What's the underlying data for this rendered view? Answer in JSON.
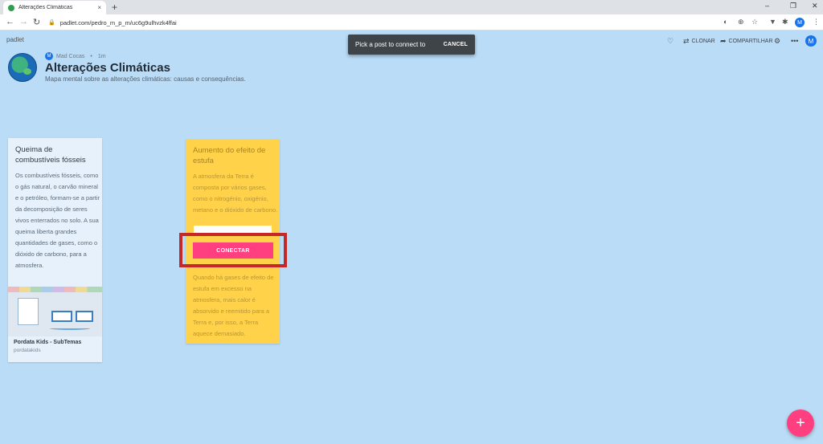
{
  "browser": {
    "tab_title": "Alterações Climáticas",
    "tab_close": "×",
    "new_tab": "+",
    "url": "padlet.com/pedro_m_p_m/uc6g9ulhvzk4ffai",
    "profile_initial": "M",
    "window_controls": [
      "–",
      "❐",
      "✕"
    ]
  },
  "padlet": {
    "logo": "padlet",
    "author": "Mad Cocas",
    "author_initial": "M",
    "time_ago": "1m",
    "title": "Alterações Climáticas",
    "subtitle": "Mapa mental sobre as alterações climáticas: causas e consequências.",
    "actions": {
      "clone": "CLONAR",
      "share": "COMPARTILHAR"
    },
    "user_initial": "M"
  },
  "snackbar": {
    "message": "Pick a post to connect to",
    "cancel": "CANCEL"
  },
  "posts": [
    {
      "title": "Queima de combustíveis fósseis",
      "body": "Os combustíveis fósseis, como o gás natural, o carvão mineral e o petróleo, formam-se a partir da decomposição de seres vivos enterrados no solo. A sua queima liberta grandes quantidades de gases, como o dióxido de carbono, para a atmosfera.",
      "link_title": "Pordata Kids - SubTemas",
      "link_host": "pordatakids"
    },
    {
      "title": "Aumento do efeito de estufa",
      "body": "A atmosfera da Terra é composta por vários gases, como o nitrogénio, oxigénio, metano e o dióxido de carbono.",
      "body2": "Quando há gases de efeito de estufa em excesso na atmosfera, mais calor é absorvido e reemitido para a Terra e, por isso, a Terra aquece demasiado.",
      "connect_label": "CONECTAR"
    }
  ],
  "fab": "+"
}
